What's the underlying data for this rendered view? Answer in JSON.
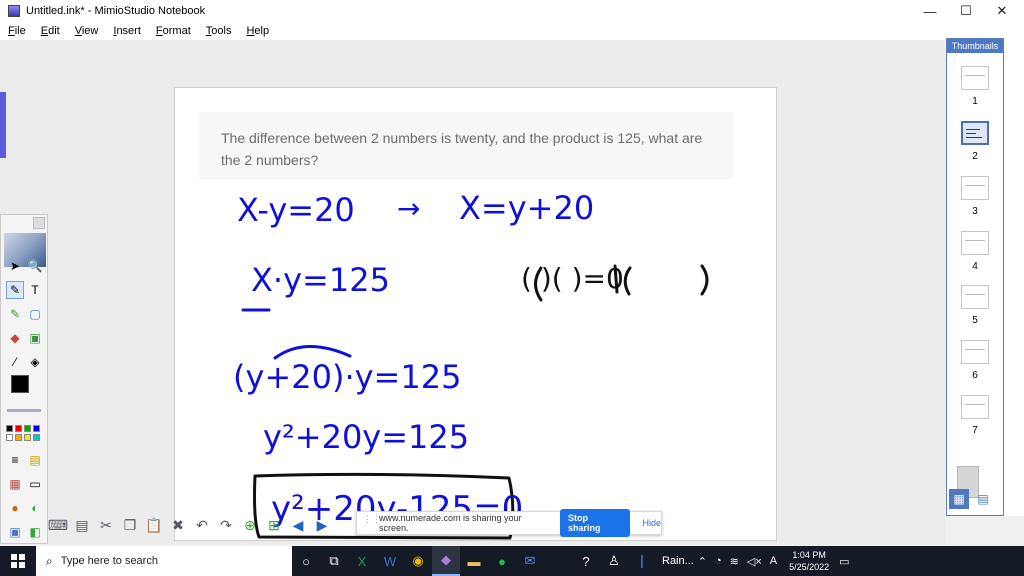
{
  "window": {
    "title": "Untitled.ink* - MimioStudio Notebook",
    "minimize": "—",
    "maximize": "☐",
    "close": "✕"
  },
  "menu": [
    "File",
    "Edit",
    "View",
    "Insert",
    "Format",
    "Tools",
    "Help"
  ],
  "page": {
    "question": "The difference between 2 numbers is twenty, and the product is 125, what are the 2 numbers?",
    "handwriting": {
      "line1_left": "X-y=20",
      "arrow": "→",
      "line1_right": "X=y+20",
      "line2_left": "X·y=125",
      "line2_right": "(   )(   )=0",
      "line3": "(y+20)·y=125",
      "line4": "y²+20y=125",
      "line5_boxed": "y²+20y-125=0",
      "ink_color": "#1010d8"
    }
  },
  "thumbnails": {
    "title": "Thumbnails",
    "pages": [
      "1",
      "2",
      "3",
      "4",
      "5",
      "6",
      "7"
    ],
    "selected": "2"
  },
  "share_banner": {
    "text": "www.numerade.com is sharing your screen.",
    "stop_label": "Stop sharing",
    "hide_label": "Hide"
  },
  "taskbar": {
    "search_placeholder": "Type here to search",
    "weather": "Rain...",
    "time": "1:04 PM",
    "date": "5/25/2022"
  },
  "colors": {
    "accent": "#4e79c2",
    "ink": "#1010d8",
    "share_button": "#1a73e8"
  }
}
